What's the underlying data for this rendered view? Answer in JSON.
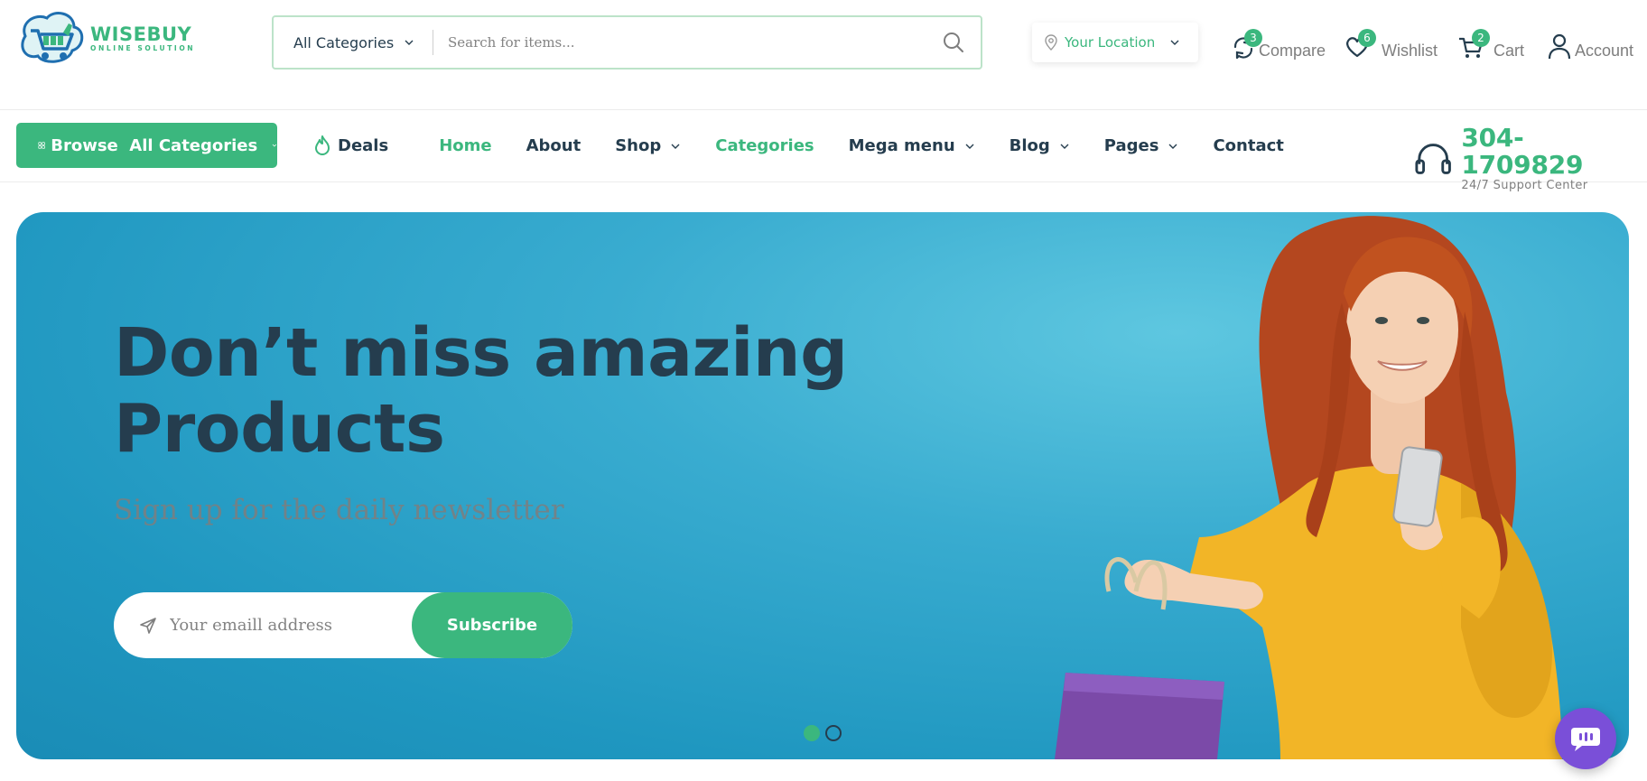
{
  "brand": {
    "name": "WISEBUY",
    "tagline": "ONLINE SOLUTION",
    "accent_color": "#3BB77E",
    "dark_text_color": "#253D4E"
  },
  "search": {
    "category_label": "All Categories",
    "placeholder": "Search for items..."
  },
  "location": {
    "label": "Your Location"
  },
  "header_actions": [
    {
      "label": "Compare",
      "count": "3",
      "icon": "compare-icon"
    },
    {
      "label": "Wishlist",
      "count": "6",
      "icon": "heart-icon"
    },
    {
      "label": "Cart",
      "count": "2",
      "icon": "cart-icon"
    },
    {
      "label": "Account",
      "icon": "user-icon"
    }
  ],
  "nav": {
    "browse_label": "Browse  All Categories",
    "deals_label": "Deals",
    "items": [
      {
        "label": "Home",
        "active": true
      },
      {
        "label": "About"
      },
      {
        "label": "Shop",
        "dropdown": true
      },
      {
        "label": "Categories",
        "active": true
      },
      {
        "label": "Mega menu",
        "dropdown": true
      },
      {
        "label": "Blog",
        "dropdown": true
      },
      {
        "label": "Pages",
        "dropdown": true
      },
      {
        "label": "Contact"
      }
    ]
  },
  "support": {
    "phone": "304- 1709829",
    "label": "24/7 Support Center"
  },
  "hero": {
    "title_line1": "Don’t miss amazing",
    "title_line2": "Products",
    "subtitle": "Sign up for the daily newsletter",
    "email_placeholder": "Your emaill address",
    "subscribe_label": "Subscribe",
    "slide_count": 2,
    "active_slide": 1
  },
  "chat": {
    "icon": "chat-icon"
  }
}
